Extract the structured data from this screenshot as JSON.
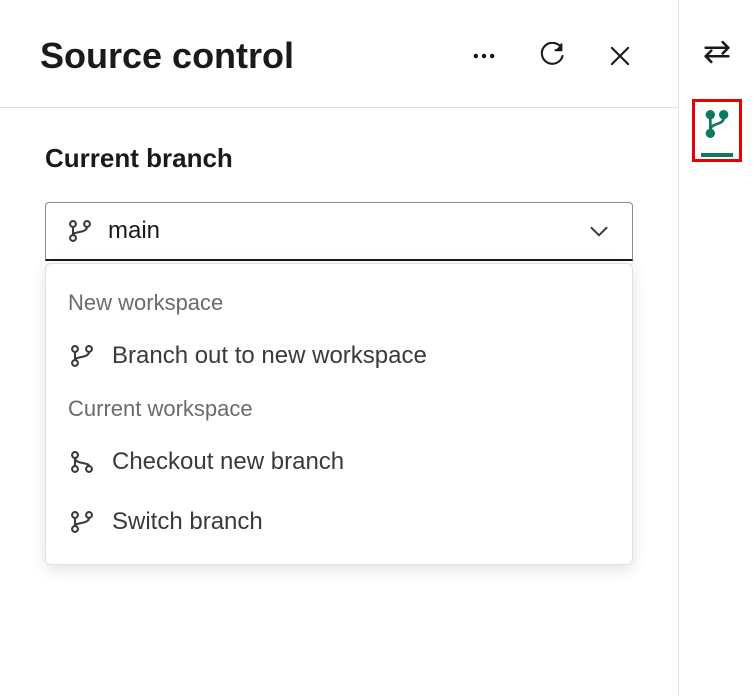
{
  "panel": {
    "title": "Source control"
  },
  "section": {
    "label": "Current branch"
  },
  "branch": {
    "value": "main"
  },
  "dropdown": {
    "sections": [
      {
        "label": "New workspace",
        "items": [
          {
            "label": "Branch out to new workspace"
          }
        ]
      },
      {
        "label": "Current workspace",
        "items": [
          {
            "label": "Checkout new branch"
          },
          {
            "label": "Switch branch"
          }
        ]
      }
    ]
  }
}
